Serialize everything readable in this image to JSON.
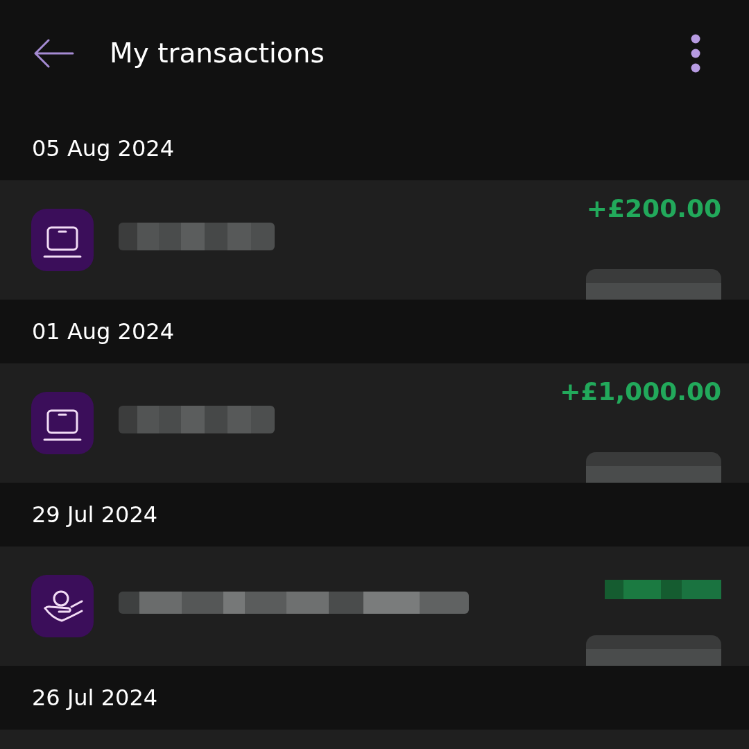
{
  "header": {
    "title": "My transactions"
  },
  "groups": [
    {
      "date": "05 Aug 2024",
      "transactions": [
        {
          "kind": "laptop",
          "name_redaction": {
            "kind": "short"
          },
          "amount": "+£200.00",
          "detail_redacted": true
        }
      ]
    },
    {
      "date": "01 Aug 2024",
      "transactions": [
        {
          "kind": "laptop",
          "name_redaction": {
            "kind": "short"
          },
          "amount": "+£1,000.00",
          "detail_redacted": true
        }
      ]
    },
    {
      "date": "29 Jul 2024",
      "transactions": [
        {
          "kind": "coin",
          "name_redaction": {
            "kind": "long"
          },
          "amount_redacted": true,
          "detail_redacted": true
        }
      ]
    },
    {
      "date": "26 Jul 2024"
    }
  ]
}
